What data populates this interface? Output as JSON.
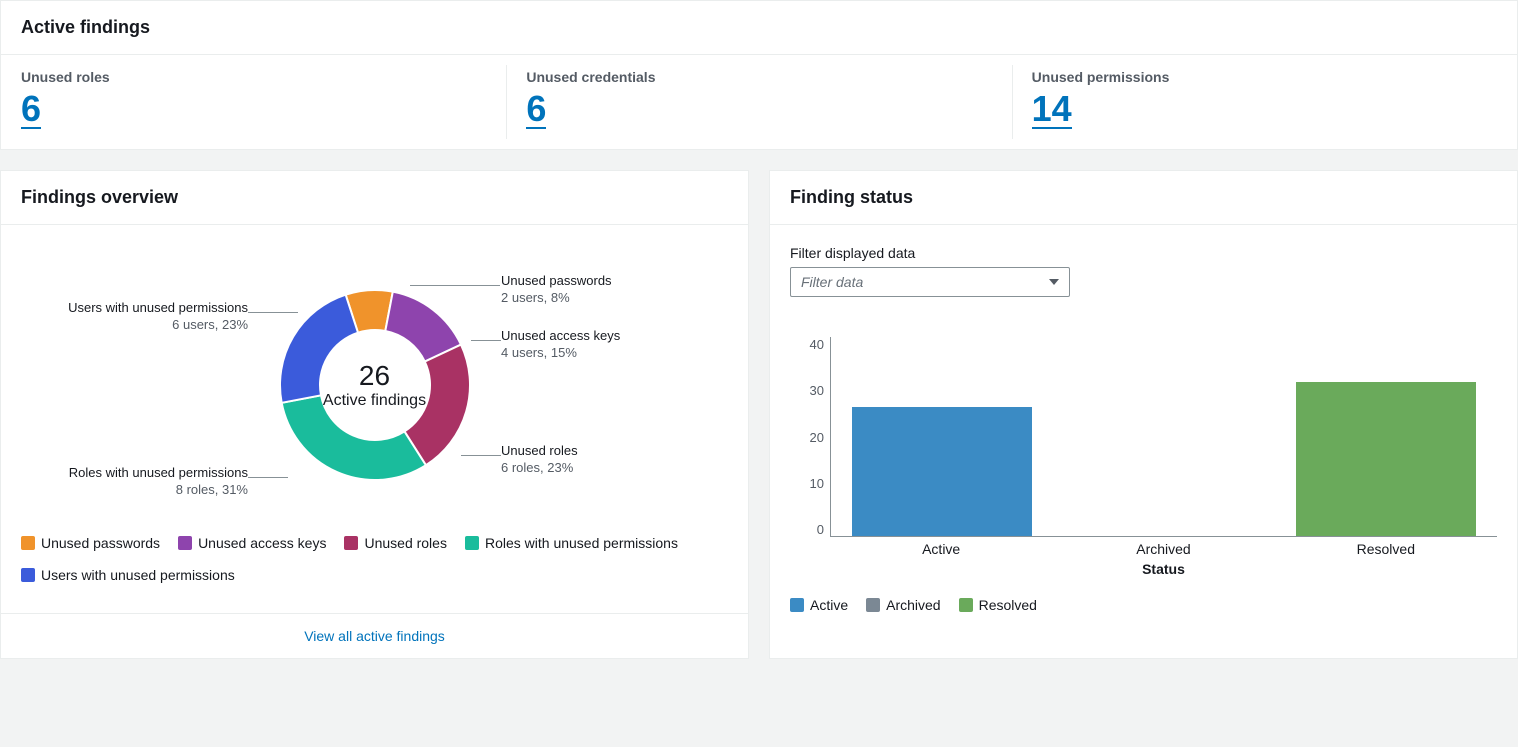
{
  "active_findings": {
    "title": "Active findings",
    "metrics": [
      {
        "label": "Unused roles",
        "value": "6"
      },
      {
        "label": "Unused credentials",
        "value": "6"
      },
      {
        "label": "Unused permissions",
        "value": "14"
      }
    ]
  },
  "overview": {
    "title": "Findings overview",
    "center_value": "26",
    "center_label": "Active findings",
    "slices": [
      {
        "name": "Unused passwords",
        "detail": "2 users, 8%",
        "color": "#f0932b"
      },
      {
        "name": "Unused access keys",
        "detail": "4 users, 15%",
        "color": "#8e44ad"
      },
      {
        "name": "Unused roles",
        "detail": "6 roles, 23%",
        "color": "#a93264"
      },
      {
        "name": "Roles with unused permissions",
        "detail": "8 roles, 31%",
        "color": "#1abc9c"
      },
      {
        "name": "Users with unused permissions",
        "detail": "6 users, 23%",
        "color": "#3b5bdb"
      }
    ],
    "legend": [
      {
        "label": "Unused passwords",
        "color": "#f0932b"
      },
      {
        "label": "Unused access keys",
        "color": "#8e44ad"
      },
      {
        "label": "Unused roles",
        "color": "#a93264"
      },
      {
        "label": "Roles with unused permissions",
        "color": "#1abc9c"
      },
      {
        "label": "Users with unused permissions",
        "color": "#3b5bdb"
      }
    ],
    "view_all": "View all active findings"
  },
  "status": {
    "title": "Finding status",
    "filter_label": "Filter displayed data",
    "filter_placeholder": "Filter data",
    "x_title": "Status",
    "legend": [
      {
        "label": "Active",
        "color": "#3b8bc4"
      },
      {
        "label": "Archived",
        "color": "#7b8894"
      },
      {
        "label": "Resolved",
        "color": "#6aaa5b"
      }
    ]
  },
  "chart_data": [
    {
      "type": "pie",
      "title": "Findings overview",
      "series": [
        {
          "name": "Unused passwords",
          "value": 2,
          "percent": 8,
          "unit": "users"
        },
        {
          "name": "Unused access keys",
          "value": 4,
          "percent": 15,
          "unit": "users"
        },
        {
          "name": "Unused roles",
          "value": 6,
          "percent": 23,
          "unit": "roles"
        },
        {
          "name": "Roles with unused permissions",
          "value": 8,
          "percent": 31,
          "unit": "roles"
        },
        {
          "name": "Users with unused permissions",
          "value": 6,
          "percent": 23,
          "unit": "users"
        }
      ],
      "total": 26
    },
    {
      "type": "bar",
      "title": "Finding status",
      "categories": [
        "Active",
        "Archived",
        "Resolved"
      ],
      "values": [
        26,
        0,
        31
      ],
      "xlabel": "Status",
      "ylabel": "",
      "ylim": [
        0,
        40
      ],
      "yticks": [
        0,
        10,
        20,
        30,
        40
      ],
      "colors": [
        "#3b8bc4",
        "#7b8894",
        "#6aaa5b"
      ]
    }
  ]
}
